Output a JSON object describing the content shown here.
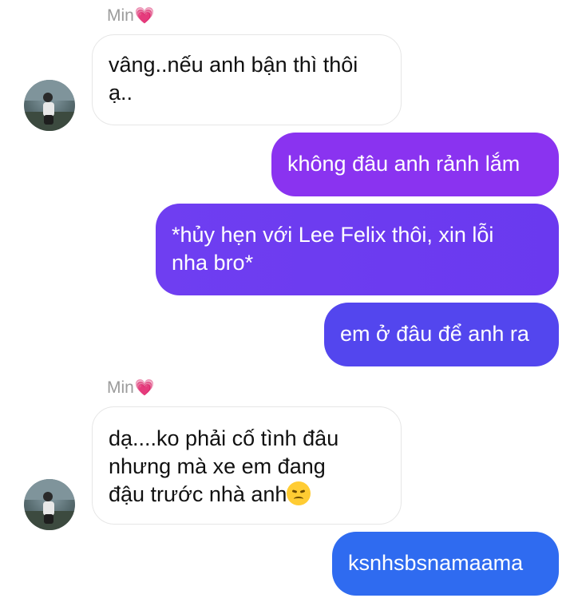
{
  "messages": [
    {
      "sender": "Min",
      "sender_heart": "💗",
      "lines": [
        "vâng..nếu anh bận thì thôi",
        "ạ.."
      ]
    },
    {
      "lines": [
        "không đâu anh rảnh lắm"
      ],
      "color": "#8a33f0"
    },
    {
      "lines": [
        "*hủy hẹn với Lee Felix thôi, xin lỗi",
        "nha bro*"
      ],
      "color": "#6d3df0"
    },
    {
      "lines": [
        "em ở đâu để anh ra"
      ],
      "color": "#5346ee"
    },
    {
      "sender": "Min",
      "sender_heart": "💗",
      "lines": [
        "dạ....ko phải cố tình đâu",
        "nhưng mà xe em đang",
        "đậu trước nhà anh"
      ],
      "emoji": "disappointed-face"
    },
    {
      "lines": [
        "ksnhsbsnamaama"
      ],
      "color": "#2f6bf0"
    }
  ],
  "colors": {
    "incoming_bubble": "#ffffff",
    "incoming_border": "#e6e6e6",
    "sender_name": "#9b9b9b",
    "heart": "#ff5c93"
  }
}
